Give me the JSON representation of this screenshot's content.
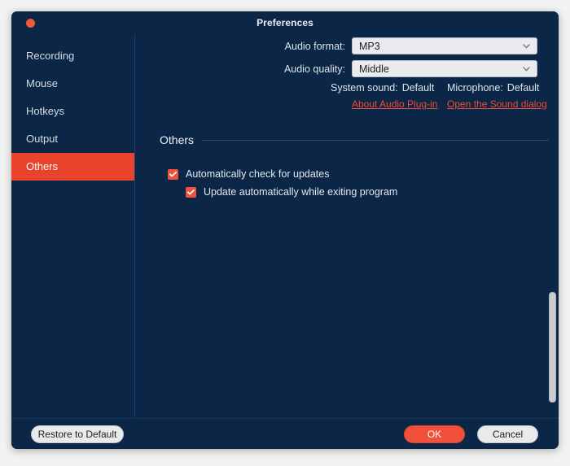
{
  "window": {
    "title": "Preferences",
    "close_icon": "close-icon",
    "accent_color": "#e8432c",
    "background_color": "#0b2647"
  },
  "sidebar": {
    "items": [
      {
        "label": "Recording",
        "selected": false
      },
      {
        "label": "Mouse",
        "selected": false
      },
      {
        "label": "Hotkeys",
        "selected": false
      },
      {
        "label": "Output",
        "selected": false
      },
      {
        "label": "Others",
        "selected": true
      }
    ]
  },
  "audio": {
    "format_label": "Audio format:",
    "format_value": "MP3",
    "quality_label": "Audio quality:",
    "quality_value": "Middle",
    "system_sound_label": "System sound:",
    "system_sound_value": "Default",
    "microphone_label": "Microphone:",
    "microphone_value": "Default",
    "link_about_plugin": "About Audio Plug-in",
    "link_sound_dialog": "Open the Sound dialog",
    "chevron_icon": "chevron-down-icon"
  },
  "others": {
    "section_title": "Others",
    "checkboxes": [
      {
        "label": "Automatically check for updates",
        "checked": true
      },
      {
        "label": "Update automatically while exiting program",
        "checked": true
      }
    ],
    "check_icon": "check-icon"
  },
  "footer": {
    "restore_label": "Restore to Default",
    "ok_label": "OK",
    "cancel_label": "Cancel"
  },
  "scrollbar": {
    "orientation": "vertical",
    "thumb_position": "lower"
  }
}
